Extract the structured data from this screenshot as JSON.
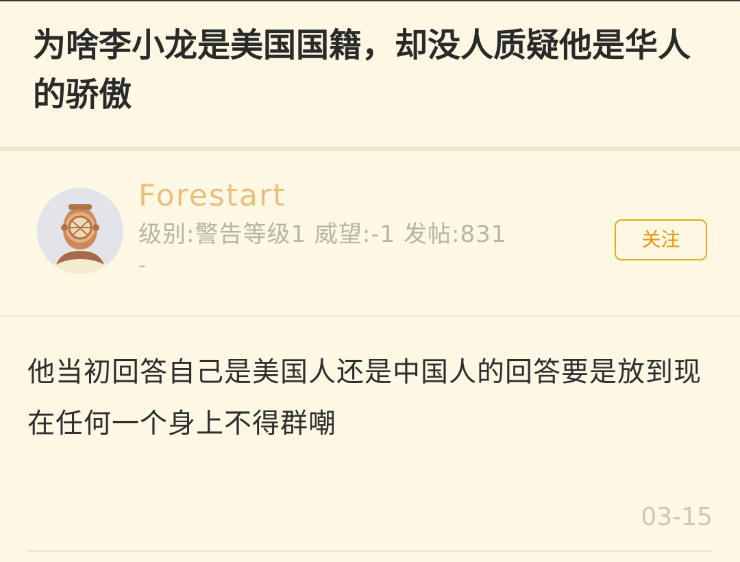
{
  "post": {
    "title": "为啥李小龙是美国国籍，却没人质疑他是华人的骄傲"
  },
  "author": {
    "name": "Forestart",
    "meta": "级别:警告等级1 威望:-1 发帖:831",
    "extra": "-",
    "avatar_icon": "diving-helmet-icon",
    "follow_label": "关注"
  },
  "reply": {
    "content": "他当初回答自己是美国人还是中国人的回答要是放到现在任何一个身上不得群嘲",
    "date": "03-15"
  },
  "colors": {
    "background": "#fcf8e3",
    "accent": "#f0a418",
    "author_name": "#e9bf80",
    "muted": "#b9b5a6"
  }
}
